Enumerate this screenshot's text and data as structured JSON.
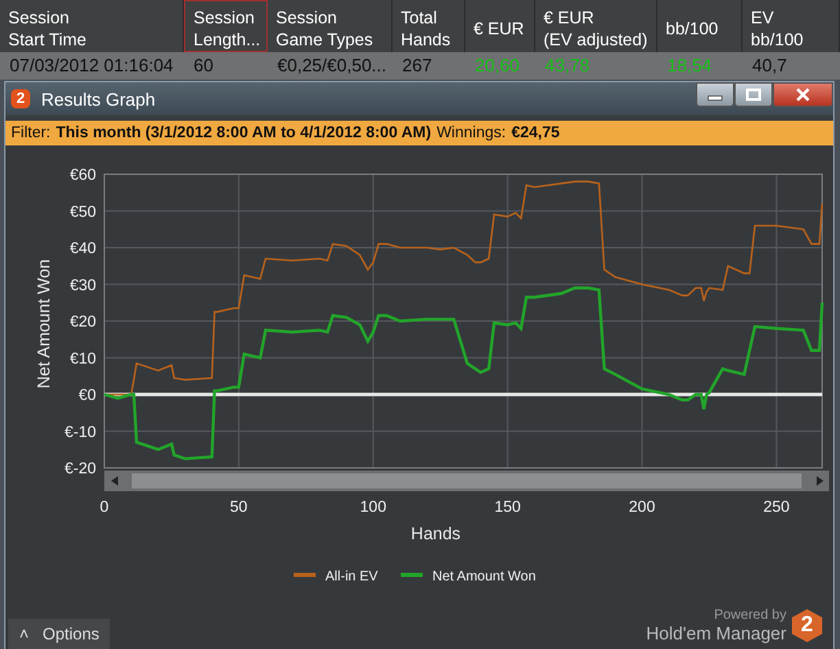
{
  "table": {
    "columns": [
      {
        "lines": [
          "Session",
          "Start Time"
        ],
        "selected": false
      },
      {
        "lines": [
          "Session",
          "Length..."
        ],
        "selected": true
      },
      {
        "lines": [
          "Session",
          "Game Types"
        ],
        "selected": false
      },
      {
        "lines": [
          "Total",
          "Hands"
        ],
        "selected": false
      },
      {
        "lines": [
          "€ EUR"
        ],
        "selected": false
      },
      {
        "lines": [
          "€ EUR",
          "(EV adjusted)"
        ],
        "selected": false
      },
      {
        "lines": [
          "bb/100"
        ],
        "selected": false
      },
      {
        "lines": [
          "EV",
          "bb/100"
        ],
        "selected": false
      }
    ],
    "rows": [
      {
        "cells": [
          {
            "text": "07/03/2012 01:16:04",
            "positive": false
          },
          {
            "text": "60",
            "positive": false
          },
          {
            "text": "€0,25/€0,50...",
            "positive": false
          },
          {
            "text": "267",
            "positive": false
          },
          {
            "text": "20,60",
            "positive": true
          },
          {
            "text": "43,78",
            "positive": true
          },
          {
            "text": "18,54",
            "positive": true
          },
          {
            "text": "40,7",
            "positive": false
          }
        ]
      }
    ]
  },
  "window": {
    "logo": "2",
    "title": "Results Graph"
  },
  "filter": {
    "label": "Filter:",
    "value": "This month (3/1/2012 8:00 AM to 4/1/2012 8:00 AM)",
    "winnings_label": "Winnings:",
    "winnings_value": "€24,75"
  },
  "chart_data": {
    "type": "line",
    "grid": true,
    "legend": true,
    "xlabel": "Hands",
    "ylabel": "Net Amount Won",
    "xlim": [
      0,
      267
    ],
    "ylim": [
      -20,
      60
    ],
    "xticks": [
      0,
      50,
      100,
      150,
      200,
      250
    ],
    "yticks": [
      {
        "value": 60,
        "label": "€60"
      },
      {
        "value": 50,
        "label": "€50"
      },
      {
        "value": 40,
        "label": "€40"
      },
      {
        "value": 30,
        "label": "€30"
      },
      {
        "value": 20,
        "label": "€20"
      },
      {
        "value": 10,
        "label": "€10"
      },
      {
        "value": 0,
        "label": "€0"
      },
      {
        "value": -10,
        "label": "€-10"
      },
      {
        "value": -20,
        "label": "€-20"
      }
    ],
    "x": [
      0,
      5,
      10,
      11,
      12,
      20,
      25,
      26,
      30,
      40,
      41,
      42,
      48,
      50,
      52,
      55,
      58,
      60,
      70,
      80,
      83,
      85,
      90,
      95,
      98,
      100,
      102,
      105,
      110,
      120,
      125,
      130,
      135,
      138,
      140,
      143,
      145,
      150,
      153,
      155,
      157,
      160,
      170,
      175,
      180,
      184,
      186,
      190,
      200,
      210,
      215,
      217,
      220,
      222,
      223,
      224,
      225,
      230,
      232,
      238,
      240,
      242,
      250,
      260,
      263,
      266,
      267
    ],
    "series": [
      {
        "name": "All-in EV",
        "color": "#b8621b",
        "values": [
          0,
          0,
          0,
          4,
          8.5,
          6.5,
          8,
          4.5,
          4,
          4.5,
          22.5,
          22.5,
          23.5,
          23.5,
          32.5,
          32,
          31.5,
          37,
          36.5,
          37,
          36.5,
          41,
          40.5,
          38,
          34,
          36,
          41,
          41,
          40,
          40,
          39.5,
          40,
          38,
          36,
          36,
          37,
          49,
          48.5,
          49.5,
          48,
          57,
          56.5,
          57.5,
          58,
          58,
          57.5,
          34,
          32,
          30,
          28.5,
          27,
          27,
          29,
          29,
          25.5,
          28,
          29,
          28.5,
          35,
          33,
          33,
          46,
          46,
          45,
          41,
          41,
          52
        ]
      },
      {
        "name": "Net Amount Won",
        "color": "#22a52a",
        "values": [
          0,
          -1,
          0,
          0,
          -13,
          -15,
          -13.5,
          -16.5,
          -17.5,
          -17,
          1,
          1,
          2,
          2,
          11,
          10.5,
          10,
          17.5,
          17,
          17.5,
          17,
          21.5,
          21,
          19,
          14.5,
          17,
          21.5,
          21.5,
          20,
          20.5,
          20.5,
          20.5,
          8.5,
          7,
          6,
          7,
          19.5,
          19,
          19.5,
          18,
          26.5,
          26.5,
          27.5,
          29,
          29,
          28.5,
          7,
          5.5,
          1.5,
          0,
          -1.5,
          -1.5,
          0,
          0,
          -4,
          0,
          0.5,
          7,
          6.5,
          5.5,
          12,
          18.5,
          18,
          17.5,
          12,
          12,
          25
        ]
      }
    ]
  },
  "options_button": {
    "caret": "˄",
    "label": "Options"
  },
  "branding": {
    "powered_by": "Powered by",
    "product": "Hold'em Manager",
    "badge": "2"
  }
}
